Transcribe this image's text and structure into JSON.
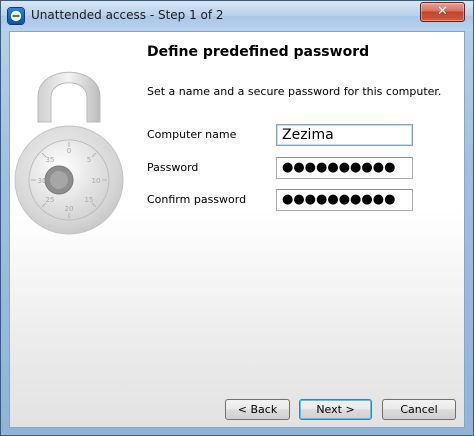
{
  "window": {
    "title": "Unattended access - Step 1 of 2",
    "close_label": "✕"
  },
  "page": {
    "heading": "Define predefined password",
    "description": "Set a name and a secure password for this computer."
  },
  "form": {
    "computer_name_label": "Computer name",
    "computer_name_value": "Zezima",
    "password_label": "Password",
    "password_mask": "●●●●●●●●●●",
    "confirm_label": "Confirm password",
    "confirm_mask": "●●●●●●●●●●"
  },
  "buttons": {
    "back": "< Back",
    "next": "Next >",
    "cancel": "Cancel"
  },
  "colors": {
    "titlebar": "#b9d3ea",
    "close_button": "#c2422b",
    "default_button_focus": "#3c7fb1"
  },
  "icons": {
    "app": "teamviewer-icon",
    "illustration": "padlock-icon"
  }
}
